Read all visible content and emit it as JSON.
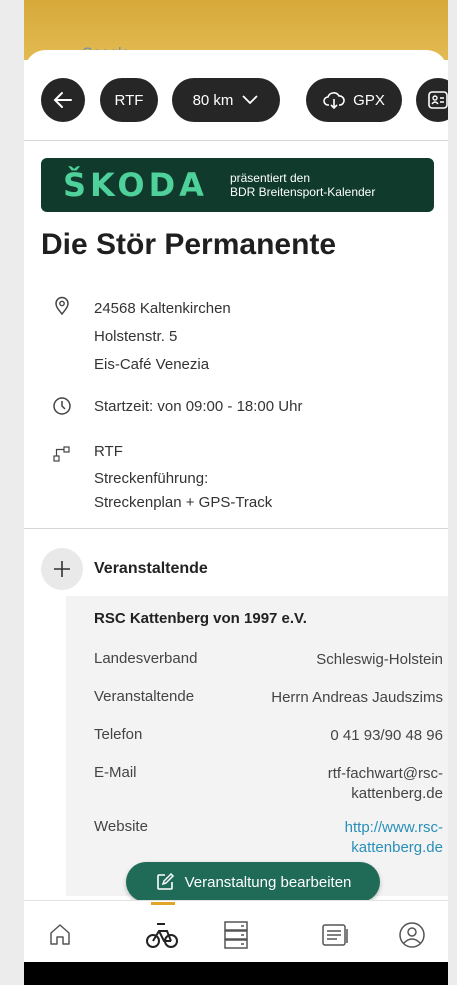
{
  "map": {
    "google_text": "Google"
  },
  "toolbar": {
    "back_icon": "arrow-left-icon",
    "type_label": "RTF",
    "distance_label": "80 km",
    "gpx_label": "GPX",
    "contact_icon": "contact-card-icon"
  },
  "banner": {
    "brand": "ŠKODA",
    "line1": "präsentiert den",
    "line2": "BDR Breitensport-Kalender"
  },
  "event": {
    "title": "Die Stör Permanente",
    "address": [
      "24568 Kaltenkirchen",
      "Holstenstr. 5",
      "Eis-Café Venezia"
    ],
    "start": "Startzeit: von 09:00 - 18:00 Uhr",
    "route_type": "RTF",
    "route_label": "Streckenführung:",
    "route_value": "Streckenplan + GPS-Track"
  },
  "organizer": {
    "section_title": "Veranstaltende",
    "name": "RSC Kattenberg von 1997 e.V.",
    "rows": [
      {
        "label": "Landesverband",
        "value": "Schleswig-Holstein"
      },
      {
        "label": "Veranstaltende",
        "value": "Herrn Andreas Jaudszims"
      },
      {
        "label": "Telefon",
        "value": "0 41 93/90 48 96"
      },
      {
        "label": "E-Mail",
        "value1": "rtf-fachwart@rsc-",
        "value2": "kattenberg.de"
      },
      {
        "label": "Website",
        "value1": "http://www.rsc-",
        "value2": "kattenberg.de"
      }
    ]
  },
  "edit_button": {
    "label": "Veranstaltung bearbeiten"
  },
  "colors": {
    "accent": "#1f6b57",
    "banner": "#0f3a2c",
    "brand_green": "#4ed19a",
    "active_tab": "#e0a52a",
    "link": "#2a8fb8"
  },
  "navbar": {
    "items": [
      "home-icon",
      "cycling-icon",
      "list-icon",
      "news-icon",
      "profile-icon"
    ],
    "active": "cycling-icon"
  }
}
